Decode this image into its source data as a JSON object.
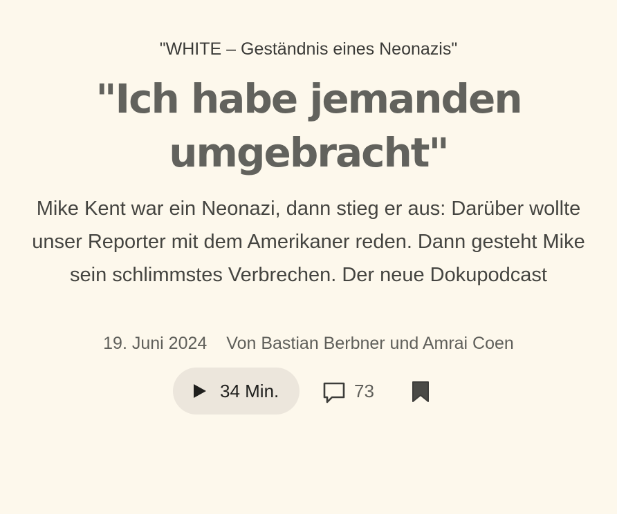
{
  "article": {
    "kicker": "\"WHITE – Geständnis eines Neonazis\"",
    "headline": "\"Ich habe jemanden umgebracht\"",
    "teaser": "Mike Kent war ein Neonazi, dann stieg er aus: Darüber wollte unser Reporter mit dem Amerikaner reden. Dann gesteht Mike sein schlimmstes Verbrechen. Der neue Dokupodcast",
    "date": "19. Juni 2024",
    "byline": "Von Bastian Berbner und Amrai Coen"
  },
  "actions": {
    "duration_label": "34 Min.",
    "comment_count": "73",
    "icons": {
      "play": "play-icon",
      "comments": "speech-bubble-icon",
      "bookmark": "bookmark-icon"
    }
  },
  "colors": {
    "background": "#fdf8ec",
    "headline": "#62625d",
    "text": "#444440",
    "play_button_bg": "#ece6dc",
    "icon": "#3d3d3a"
  }
}
